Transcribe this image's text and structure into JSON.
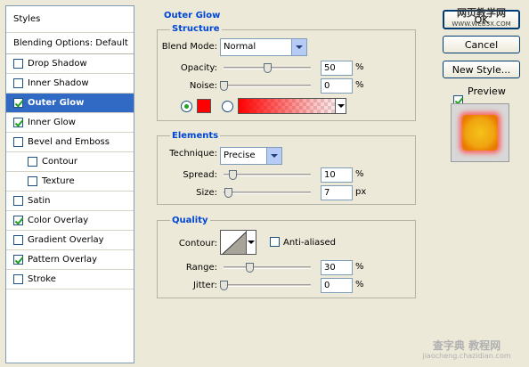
{
  "styles_list": {
    "header": "Styles",
    "items": [
      {
        "label": "Blending Options: Default",
        "checkbox": false,
        "checked": false,
        "indent": 0,
        "selected": false,
        "kind": "header"
      },
      {
        "label": "Drop Shadow",
        "checkbox": true,
        "checked": false,
        "indent": 0,
        "selected": false
      },
      {
        "label": "Inner Shadow",
        "checkbox": true,
        "checked": false,
        "indent": 0,
        "selected": false
      },
      {
        "label": "Outer Glow",
        "checkbox": true,
        "checked": true,
        "indent": 0,
        "selected": true
      },
      {
        "label": "Inner Glow",
        "checkbox": true,
        "checked": true,
        "indent": 0,
        "selected": false
      },
      {
        "label": "Bevel and Emboss",
        "checkbox": true,
        "checked": false,
        "indent": 0,
        "selected": false
      },
      {
        "label": "Contour",
        "checkbox": true,
        "checked": false,
        "indent": 1,
        "selected": false
      },
      {
        "label": "Texture",
        "checkbox": true,
        "checked": false,
        "indent": 1,
        "selected": false
      },
      {
        "label": "Satin",
        "checkbox": true,
        "checked": false,
        "indent": 0,
        "selected": false
      },
      {
        "label": "Color Overlay",
        "checkbox": true,
        "checked": true,
        "indent": 0,
        "selected": false
      },
      {
        "label": "Gradient Overlay",
        "checkbox": true,
        "checked": false,
        "indent": 0,
        "selected": false
      },
      {
        "label": "Pattern Overlay",
        "checkbox": true,
        "checked": true,
        "indent": 0,
        "selected": false
      },
      {
        "label": "Stroke",
        "checkbox": true,
        "checked": false,
        "indent": 0,
        "selected": false
      }
    ]
  },
  "outer_glow": {
    "title": "Outer Glow",
    "structure": {
      "title": "Structure",
      "blend_mode_label": "Blend Mode:",
      "blend_mode_value": "Normal",
      "opacity_label": "Opacity:",
      "opacity_value": "50",
      "opacity_unit": "%",
      "opacity_level": 0.5,
      "noise_label": "Noise:",
      "noise_value": "0",
      "noise_unit": "%",
      "noise_level": 0,
      "glow_color": "#ff0000",
      "solid_color_selected": true
    },
    "elements": {
      "title": "Elements",
      "technique_label": "Technique:",
      "technique_value": "Precise",
      "spread_label": "Spread:",
      "spread_value": "10",
      "spread_unit": "%",
      "spread_level": 0.1,
      "size_label": "Size:",
      "size_value": "7",
      "size_unit": "px",
      "size_level": 0.05
    },
    "quality": {
      "title": "Quality",
      "contour_label": "Contour:",
      "anti_aliased_label": "Anti-aliased",
      "anti_aliased_checked": false,
      "range_label": "Range:",
      "range_value": "30",
      "range_unit": "%",
      "range_level": 0.3,
      "jitter_label": "Jitter:",
      "jitter_value": "0",
      "jitter_unit": "%",
      "jitter_level": 0
    }
  },
  "buttons": {
    "ok": "OK",
    "cancel": "Cancel",
    "new_style": "New Style...",
    "preview_label": "Preview",
    "preview_checked": true
  },
  "watermarks": {
    "top_right": "网页教学网",
    "top_right_url": "WWW.WEB3X.COM",
    "bottom_right": "查字典 教程网",
    "bottom_right_url": "jiaocheng.chazidian.com"
  }
}
